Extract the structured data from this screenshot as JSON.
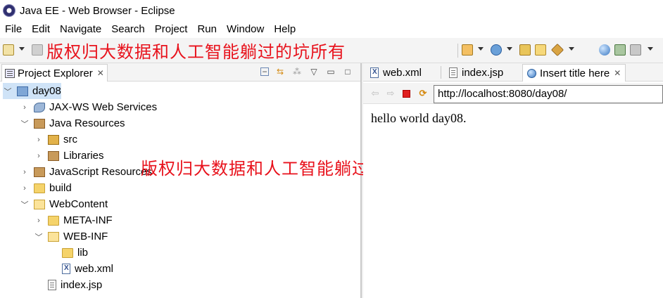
{
  "window": {
    "title": "Java EE - Web Browser - Eclipse"
  },
  "menu": [
    "File",
    "Edit",
    "Navigate",
    "Search",
    "Project",
    "Run",
    "Window",
    "Help"
  ],
  "watermark": "版权归大数据和人工智能躺过的坑所有",
  "project_explorer": {
    "title": "Project Explorer",
    "close": "✕",
    "tree": [
      {
        "label": "day08",
        "icon": "project-icon",
        "expanded": true,
        "selected": true
      },
      {
        "label": "JAX-WS Web Services",
        "icon": "web-services-icon",
        "expanded": false
      },
      {
        "label": "Java Resources",
        "icon": "java-resources-icon",
        "expanded": true
      },
      {
        "label": "src",
        "icon": "package-folder-icon",
        "expanded": false
      },
      {
        "label": "Libraries",
        "icon": "libraries-icon",
        "expanded": false
      },
      {
        "label": "JavaScript Resources",
        "icon": "javascript-resources-icon",
        "expanded": false
      },
      {
        "label": "build",
        "icon": "folder-icon",
        "expanded": false
      },
      {
        "label": "WebContent",
        "icon": "folder-open-icon",
        "expanded": true
      },
      {
        "label": "META-INF",
        "icon": "folder-icon",
        "expanded": false
      },
      {
        "label": "WEB-INF",
        "icon": "folder-open-icon",
        "expanded": true
      },
      {
        "label": "lib",
        "icon": "folder-icon"
      },
      {
        "label": "web.xml",
        "icon": "xml-file-icon"
      },
      {
        "label": "index.jsp",
        "icon": "jsp-file-icon"
      }
    ]
  },
  "editor_tabs": [
    {
      "label": "web.xml",
      "icon": "xml-file-icon"
    },
    {
      "label": "index.jsp",
      "icon": "jsp-file-icon"
    },
    {
      "label": "Insert title here",
      "icon": "globe-icon",
      "active": true,
      "close": "✕"
    }
  ],
  "browser": {
    "url": "http://localhost:8080/day08/",
    "content": "hello world day08."
  }
}
